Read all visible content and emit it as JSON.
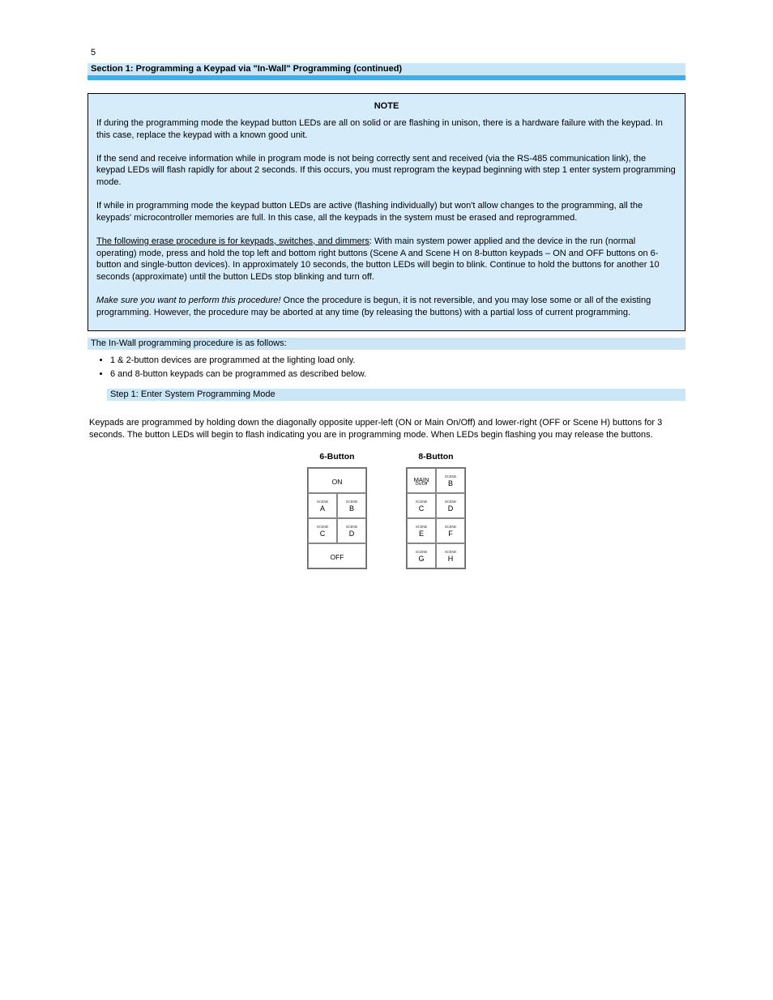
{
  "page_number": "5",
  "heading": "Section 1: Programming a Keypad via \"In-Wall\" Programming (continued)",
  "note": {
    "title": "NOTE",
    "p1": "If during the programming mode the keypad button LEDs are all on solid or are flashing in unison, there is a hardware failure with the keypad. In this case, replace the keypad with a known good unit.",
    "p2": "If the send and receive information while in program mode is not being correctly sent and received (via the RS-485 communication link), the keypad LEDs will flash rapidly for about 2 seconds. If this occurs, you must reprogram the keypad beginning with step 1 enter system programming mode.",
    "p3": "If while in programming mode the keypad button LEDs are active (flashing individually) but won't allow changes to the programming, all the keypads' microcontroller memories are full. In this case, all the keypads in the system must be erased and reprogrammed.",
    "p4_lead": "The following erase procedure is for keypads, switches, and dimmers",
    "p4_body": ": With main system power applied and the device in the run (normal operating) mode, press and hold the top left and bottom right buttons (Scene A and Scene H on 8-button keypads – ON and OFF buttons on 6-button and single-button devices). In approximately 10 seconds, the button LEDs will begin to blink. Continue to hold the buttons for another 10 seconds (approximate) until the button LEDs stop blinking and turn off.",
    "p5_lead_italic": "Make sure you want to perform this procedure!",
    "p5_body": " Once the procedure is begun, it is not reversible, and you may lose some or all of the existing programming. However, the procedure may be aborted at any time (by releasing the buttons) with a partial loss of current programming."
  },
  "procedure_title": "The In-Wall programming procedure is as follows:",
  "bullets": [
    "1 & 2-button devices are programmed at the lighting load only.",
    "6 and 8-button keypads can be programmed as described below."
  ],
  "step1_title": "Step 1: Enter System Programming Mode",
  "intro": "Keypads are programmed by holding down the diagonally opposite upper-left (ON or Main On/Off) and lower-right (OFF or Scene H) buttons for 3 seconds. The button LEDs will begin to flash indicating you are in programming mode. When LEDs begin flashing you may release the buttons.",
  "six": {
    "title": "6-Button",
    "on": "ON",
    "a_t": "SCENE",
    "a_b": "A",
    "b_t": "SCENE",
    "b_b": "B",
    "c_t": "SCENE",
    "c_b": "C",
    "d_t": "SCENE",
    "d_b": "D",
    "off": "OFF"
  },
  "eight": {
    "title": "8-Button",
    "main_top": "MAIN",
    "main_sub": "On/Off",
    "b_t": "SCENE",
    "b_b": "B",
    "c_t": "SCENE",
    "c_b": "C",
    "d_t": "SCENE",
    "d_b": "D",
    "e_t": "SCENE",
    "e_b": "E",
    "f_t": "SCENE",
    "f_b": "F",
    "g_t": "SCENE",
    "g_b": "G",
    "h_t": "SCENE",
    "h_b": "H"
  }
}
